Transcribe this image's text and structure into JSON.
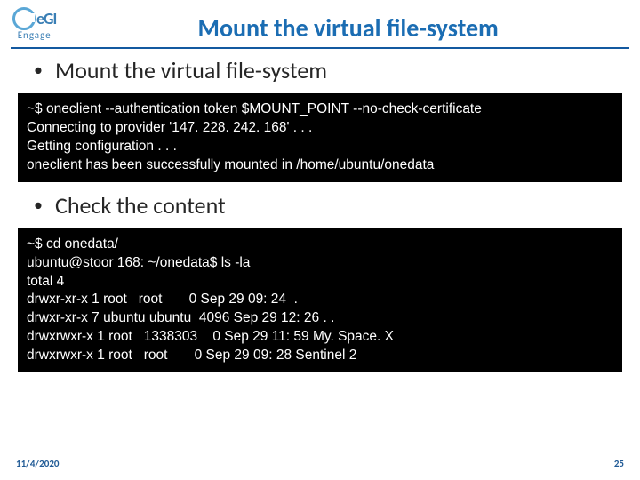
{
  "logo": {
    "text": "eGI",
    "sub": "Engage"
  },
  "title": "Mount the virtual file-system",
  "bullets": {
    "b1": "Mount the virtual file-system",
    "b2": "Check the content"
  },
  "terminals": {
    "t1": "~$ oneclient --authentication token $MOUNT_POINT --no-check-certificate\nConnecting to provider '147. 228. 242. 168' . . .\nGetting configuration . . .\noneclient has been successfully mounted in /home/ubuntu/onedata",
    "t2": "~$ cd onedata/\nubuntu@stoor 168: ~/onedata$ ls -la\ntotal 4\ndrwxr-xr-x 1 root   root       0 Sep 29 09: 24  .\ndrwxr-xr-x 7 ubuntu ubuntu  4096 Sep 29 12: 26 . .\ndrwxrwxr-x 1 root   1338303    0 Sep 29 11: 59 My. Space. X\ndrwxrwxr-x 1 root   root       0 Sep 29 09: 28 Sentinel 2"
  },
  "footer": {
    "date": "11/4/2020",
    "page": "25"
  }
}
